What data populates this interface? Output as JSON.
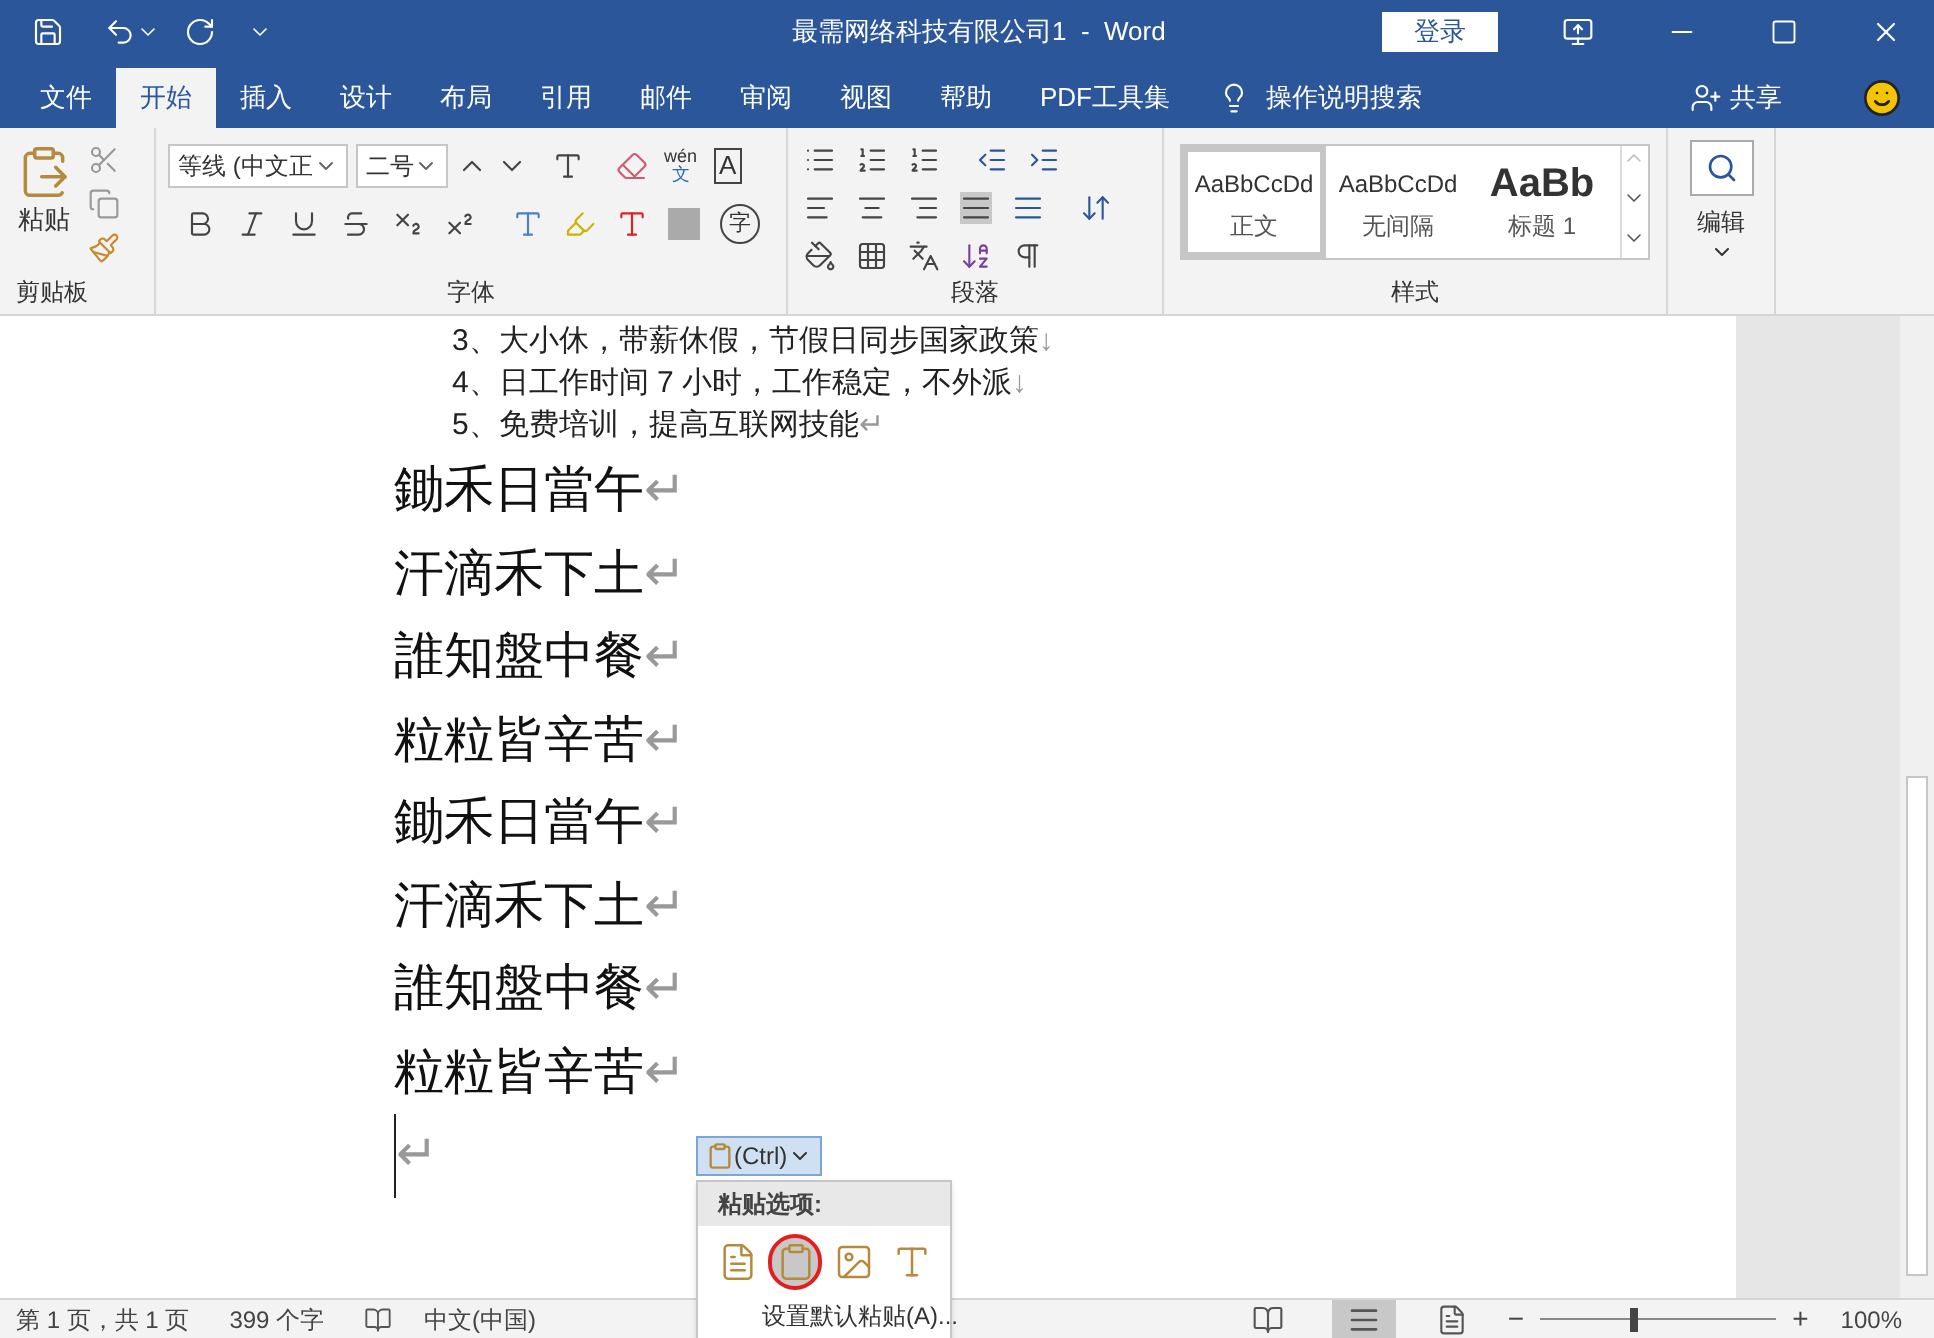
{
  "window": {
    "title": "最需网络科技有限公司1  -  Word",
    "login": "登录"
  },
  "tabs": [
    {
      "label": "文件",
      "selected": false
    },
    {
      "label": "开始",
      "selected": true
    },
    {
      "label": "插入",
      "selected": false
    },
    {
      "label": "设计",
      "selected": false
    },
    {
      "label": "布局",
      "selected": false
    },
    {
      "label": "引用",
      "selected": false
    },
    {
      "label": "邮件",
      "selected": false
    },
    {
      "label": "审阅",
      "selected": false
    },
    {
      "label": "视图",
      "selected": false
    },
    {
      "label": "帮助",
      "selected": false
    },
    {
      "label": "PDF工具集",
      "selected": false
    }
  ],
  "tell_me": "操作说明搜索",
  "share": "共享",
  "ribbon": {
    "clipboard": {
      "paste": "粘贴",
      "label": "剪贴板"
    },
    "font": {
      "name": "等线 (中文正",
      "size": "二号",
      "label": "字体",
      "pinyin_top": "wén",
      "pinyin_bottom": "文",
      "border_char": "A",
      "circle_char": "字"
    },
    "paragraph": {
      "label": "段落"
    },
    "styles": {
      "label": "样式",
      "items": [
        {
          "preview": "AaBbCcDd",
          "name": "正文",
          "kind": "body",
          "selected": true
        },
        {
          "preview": "AaBbCcDd",
          "name": "无间隔",
          "kind": "body",
          "selected": false
        },
        {
          "preview": "AaBb",
          "name": "标题 1",
          "kind": "heading",
          "selected": false
        }
      ]
    },
    "editing": {
      "label": "编辑"
    }
  },
  "document": {
    "list": [
      {
        "text": "3、大小休，带薪休假，节假日同步国家政策",
        "mark": "↓"
      },
      {
        "text": "4、日工作时间 7 小时，工作稳定，不外派",
        "mark": "↓"
      },
      {
        "text": "5、免费培训，提高互联网技能",
        "mark": "↵"
      }
    ],
    "poem": [
      {
        "text": "鋤禾日當午",
        "mark": "↵"
      },
      {
        "text": "汗滴禾下土",
        "mark": "↵"
      },
      {
        "text": "誰知盤中餐",
        "mark": "↵"
      },
      {
        "text": "粒粒皆辛苦",
        "mark": "↵"
      },
      {
        "text": "鋤禾日當午",
        "mark": "↵"
      },
      {
        "text": "汗滴禾下土",
        "mark": "↵"
      },
      {
        "text": "誰知盤中餐",
        "mark": "↵"
      },
      {
        "text": "粒粒皆辛苦",
        "mark": "↵"
      }
    ],
    "last_mark": "↵"
  },
  "paste_popup": {
    "button": "(Ctrl)",
    "header": "粘贴选项:",
    "options": [
      {
        "kind": "format",
        "selected": false
      },
      {
        "kind": "merge",
        "selected": true
      },
      {
        "kind": "picture",
        "selected": false
      },
      {
        "kind": "text",
        "selected": false
      }
    ],
    "default": "设置默认粘贴(A)..."
  },
  "status_bar": {
    "page": "第 1 页，共 1 页",
    "words": "399 个字",
    "language": "中文(中国)",
    "zoom_minus": "−",
    "zoom_plus": "+",
    "zoom": {
      "level": 0.4
    },
    "zoom_text": "100%"
  }
}
